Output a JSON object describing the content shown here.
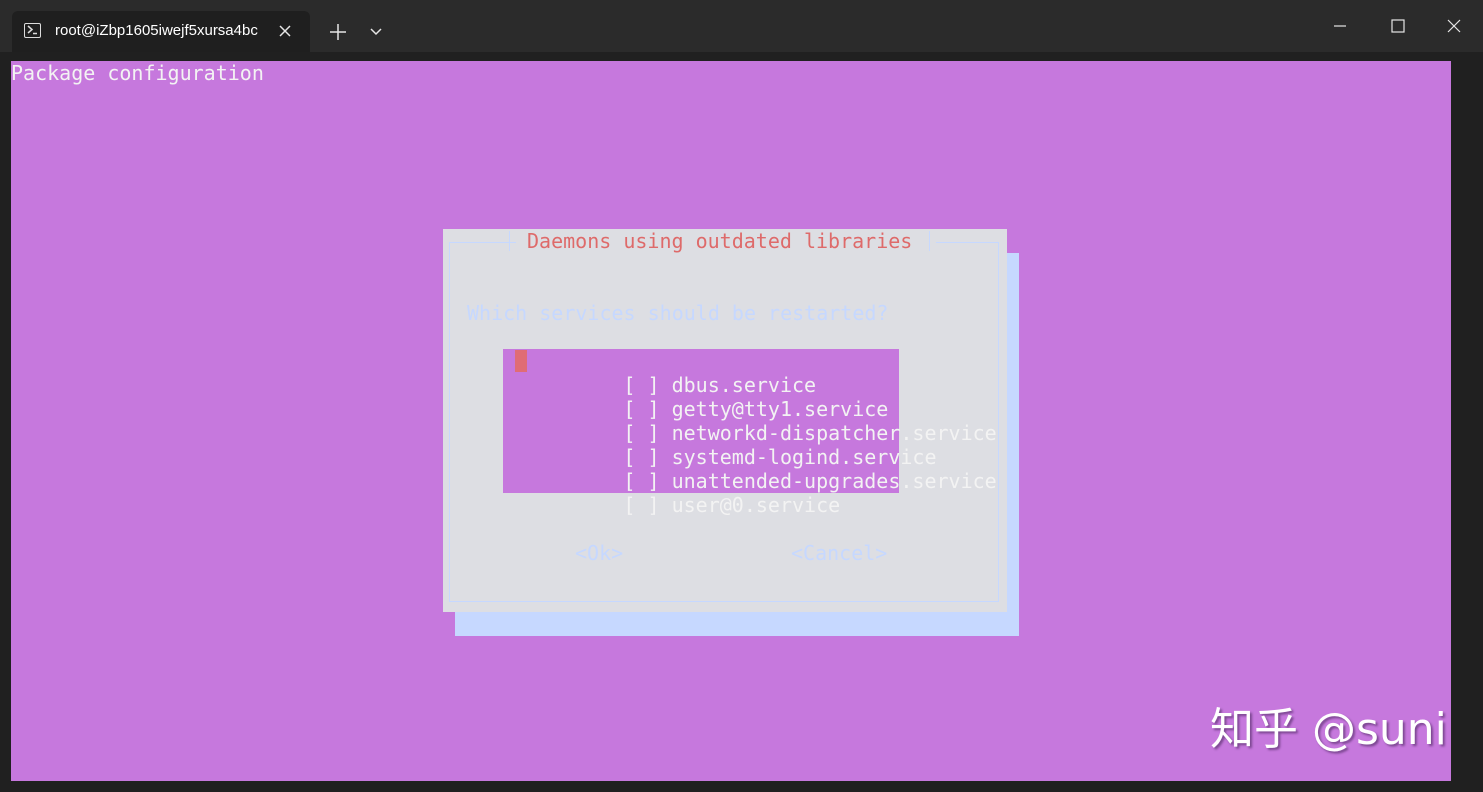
{
  "window": {
    "tab_title": "root@iZbp1605iwejf5xursa4bc",
    "tab_icon": "powershell-icon",
    "new_tab_icon": "plus-icon",
    "dropdown_icon": "chevron-down-icon",
    "controls": [
      "minimize-icon",
      "maximize-icon",
      "close-icon"
    ]
  },
  "terminal": {
    "header": "Package configuration",
    "background": "#c678dd",
    "dialog": {
      "title": "Daemons using outdated libraries",
      "prompt": "Which services should be restarted?",
      "items": [
        {
          "check": "[ ]",
          "label": "dbus.service",
          "selected": true
        },
        {
          "check": "[ ]",
          "label": "getty@tty1.service"
        },
        {
          "check": "[ ]",
          "label": "networkd-dispatcher.service"
        },
        {
          "check": "[ ]",
          "label": "systemd-logind.service"
        },
        {
          "check": "[ ]",
          "label": "unattended-upgrades.service"
        },
        {
          "check": "[ ]",
          "label": "user@0.service"
        }
      ],
      "ok_label": "<Ok>",
      "cancel_label": "<Cancel>"
    }
  },
  "watermark": "知乎 @suni",
  "colors": {
    "title_red": "#de6a6a",
    "dialog_bg": "#dddee3",
    "shadow": "#c6d8ff",
    "cursor": "#e06c75"
  }
}
